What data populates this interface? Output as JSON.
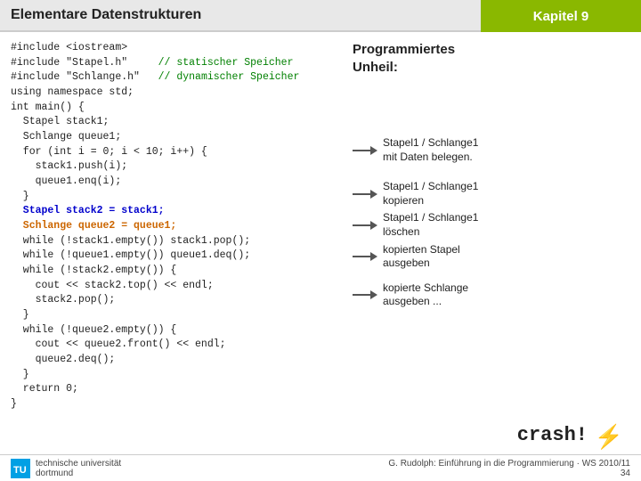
{
  "header": {
    "title": "Elementare Datenstrukturen",
    "kapitel": "Kapitel 9"
  },
  "code": {
    "lines": [
      {
        "type": "normal",
        "text": "#include <iostream>"
      },
      {
        "type": "mixed",
        "parts": [
          {
            "t": "normal",
            "v": "#include \"Stapel.h\"      "
          },
          {
            "t": "comment",
            "v": "// statischer Speicher"
          }
        ]
      },
      {
        "type": "mixed",
        "parts": [
          {
            "t": "normal",
            "v": "#include \"Schlange.h\"   "
          },
          {
            "t": "comment",
            "v": "// dynamischer Speicher"
          }
        ]
      },
      {
        "type": "normal",
        "text": "using namespace std;"
      },
      {
        "type": "normal",
        "text": "int main() {"
      },
      {
        "type": "normal",
        "text": "  Stapel stack1;"
      },
      {
        "type": "normal",
        "text": "  Schlange queue1;"
      },
      {
        "type": "normal",
        "text": "  for (int i = 0; i < 10; i++) {"
      },
      {
        "type": "normal",
        "text": "    stack1.push(i);"
      },
      {
        "type": "normal",
        "text": "    queue1.enq(i);"
      },
      {
        "type": "normal",
        "text": "  }"
      },
      {
        "type": "blue",
        "text": "  Stapel stack2 = stack1;"
      },
      {
        "type": "orange",
        "text": "  Schlange queue2 = queue1;"
      },
      {
        "type": "normal",
        "text": "  while (!stack1.empty()) stack1.pop();"
      },
      {
        "type": "normal",
        "text": "  while (!queue1.empty()) queue1.deq();"
      },
      {
        "type": "normal",
        "text": "  while (!stack2.empty()) {"
      },
      {
        "type": "normal",
        "text": "    cout << stack2.top() << endl;"
      },
      {
        "type": "normal",
        "text": "    stack2.pop();"
      },
      {
        "type": "normal",
        "text": "  }"
      },
      {
        "type": "normal",
        "text": "  while (!queue2.empty()) {"
      },
      {
        "type": "normal",
        "text": "    cout << queue2.front() << endl;"
      },
      {
        "type": "normal",
        "text": "    queue2.deq();"
      },
      {
        "type": "normal",
        "text": "  }"
      },
      {
        "type": "normal",
        "text": "  return 0;"
      },
      {
        "type": "normal",
        "text": "}"
      }
    ]
  },
  "annotations": {
    "programmiertes_unheil": "Programmiertes\nUnheil:",
    "items": [
      {
        "label": "Stapel1 / Schlange1\nmit Daten belegen."
      },
      {
        "label": "Stapel1 / Schlange1\nkopieren"
      },
      {
        "label": "Stapel1 / Schlange1\nlöschen"
      },
      {
        "label": "kopierten Stapel\nausgeben"
      },
      {
        "label": "kopierte Schlange\nausgeben ..."
      }
    ],
    "crash": "crash!"
  },
  "footer": {
    "institution": "technische universität\ndortmund",
    "copyright": "G. Rudolph: Einführung in die Programmierung · WS 2010/11",
    "page": "34"
  }
}
